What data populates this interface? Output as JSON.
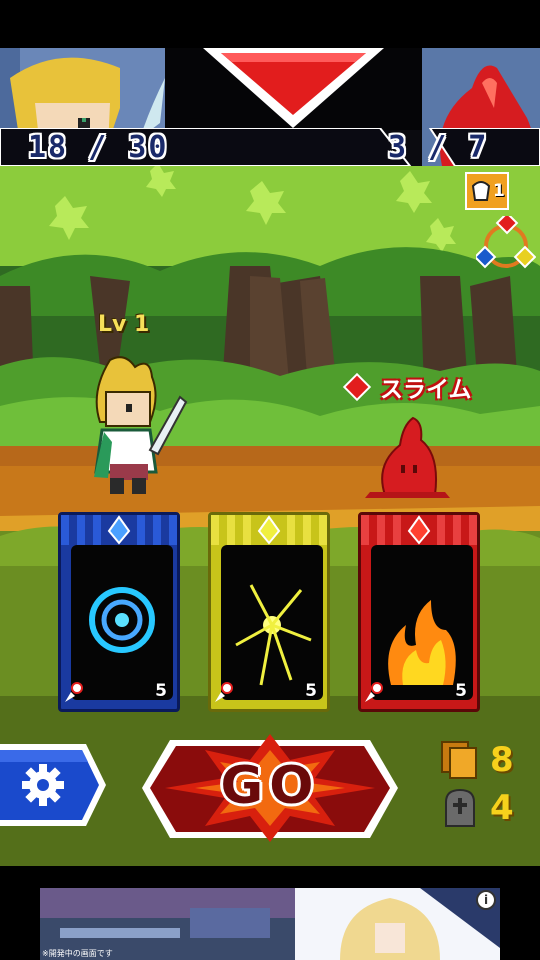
{
  "hud": {
    "hero_hp": "18 / 30",
    "enemy_hp": "3 / 7",
    "turn_indicator_icon": "red-down-triangle"
  },
  "level_badge": {
    "count": "1"
  },
  "player": {
    "level_label": "Lv 1"
  },
  "enemy": {
    "name": "スライム",
    "element_color": "#e0202a"
  },
  "cards": [
    {
      "element": "water",
      "color": "#1a5acc",
      "cost": "5",
      "icon": "whirlpool-icon"
    },
    {
      "element": "thunder",
      "color": "#d6d21a",
      "cost": "5",
      "icon": "lightning-icon"
    },
    {
      "element": "fire",
      "color": "#d0201c",
      "cost": "5",
      "icon": "flame-icon"
    }
  ],
  "controls": {
    "go_label": "GO",
    "settings_icon": "gear-icon"
  },
  "counters": {
    "deck": "8",
    "graveyard": "4"
  },
  "ad": {
    "caption": "※開発中の画面です",
    "info_icon": "info-icon"
  }
}
